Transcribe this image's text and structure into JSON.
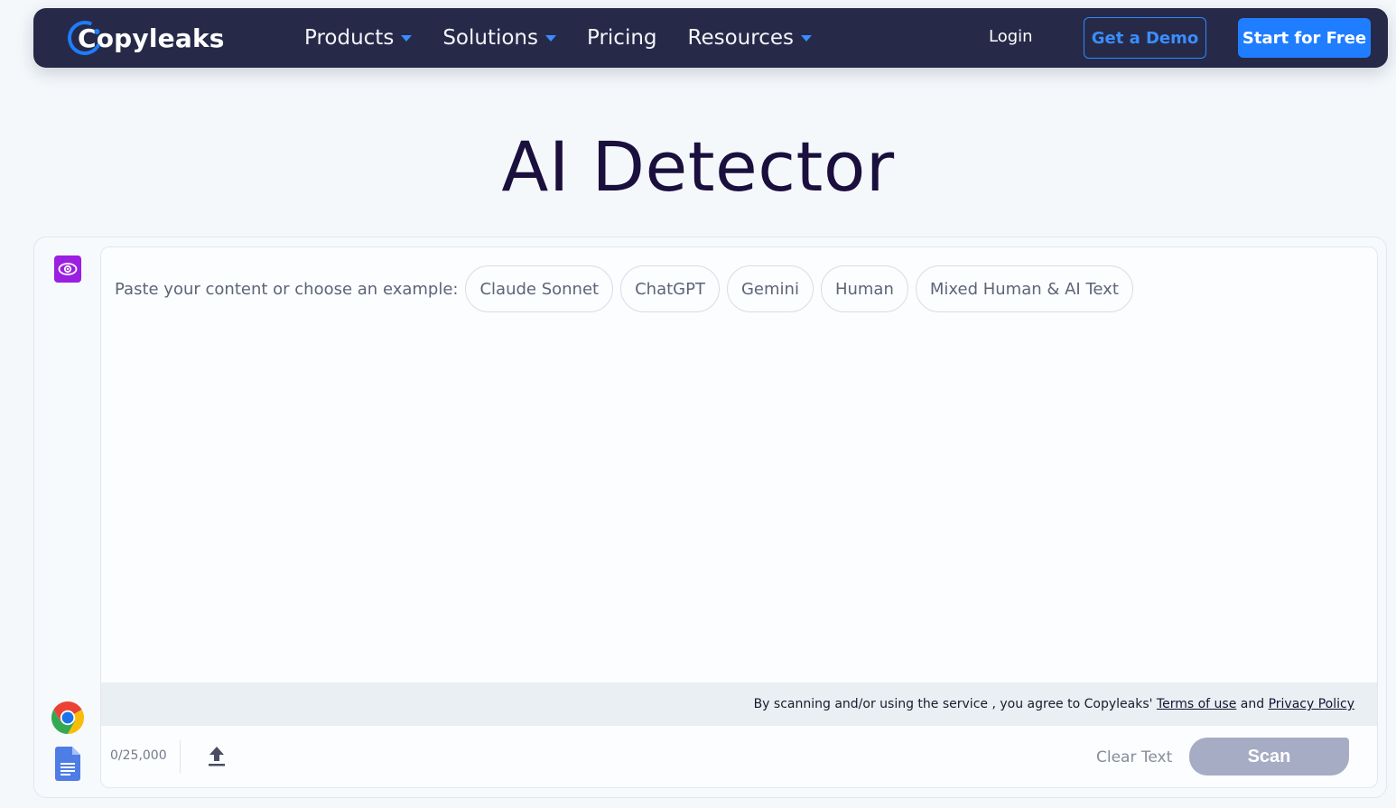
{
  "navbar": {
    "brand": "Copyleaks",
    "items": [
      {
        "label": "Products",
        "has_dropdown": true
      },
      {
        "label": "Solutions",
        "has_dropdown": true
      },
      {
        "label": "Pricing",
        "has_dropdown": false
      },
      {
        "label": "Resources",
        "has_dropdown": true
      }
    ],
    "login": "Login",
    "demo_button": "Get a Demo",
    "start_button": "Start for Free"
  },
  "page": {
    "title": "AI Detector"
  },
  "editor": {
    "prompt": "Paste your content or choose an example:",
    "examples": [
      "Claude Sonnet",
      "ChatGPT",
      "Gemini",
      "Human",
      "Mixed Human & AI Text"
    ],
    "terms": {
      "prefix": "By scanning and/or using the service , you agree to Copyleaks'",
      "terms_link": "Terms of use",
      "and": "and",
      "privacy_link": "Privacy Policy"
    },
    "char_count": "0/25,000",
    "clear_text": "Clear Text",
    "scan_button": "Scan"
  },
  "sidebar": {
    "icons": [
      "eye-icon",
      "chrome-icon",
      "google-docs-icon"
    ]
  },
  "colors": {
    "navbar_bg": "#262a48",
    "accent_blue": "#1f7dff",
    "title": "#1a0f3d",
    "scan_disabled": "#a6acc4",
    "eye_badge": "#9b1fe0"
  }
}
